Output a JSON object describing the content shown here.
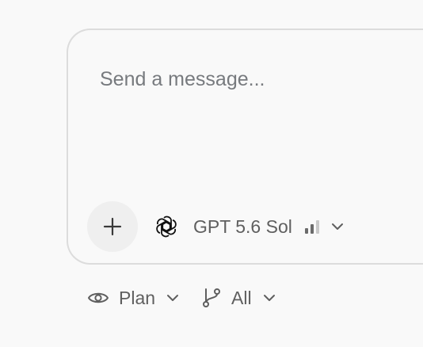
{
  "composer": {
    "placeholder": "Send a message...",
    "value": ""
  },
  "model": {
    "name": "GPT 5.6 Sol",
    "logo_icon": "openai-logo-icon",
    "signal_level": "2 of 3",
    "signal_colors": {
      "active": "#6b6b6b",
      "inactive": "#c9c9c9"
    }
  },
  "toolbar": {
    "add_icon": "plus-icon",
    "mode_label": "Plan",
    "mode_icon": "eye-icon",
    "branch_label": "All",
    "branch_icon": "git-branch-icon"
  },
  "colors": {
    "background": "#f9f9f9",
    "border": "#dcdcdc",
    "text_muted": "#5f5f5f",
    "button_bg": "#efefef"
  }
}
